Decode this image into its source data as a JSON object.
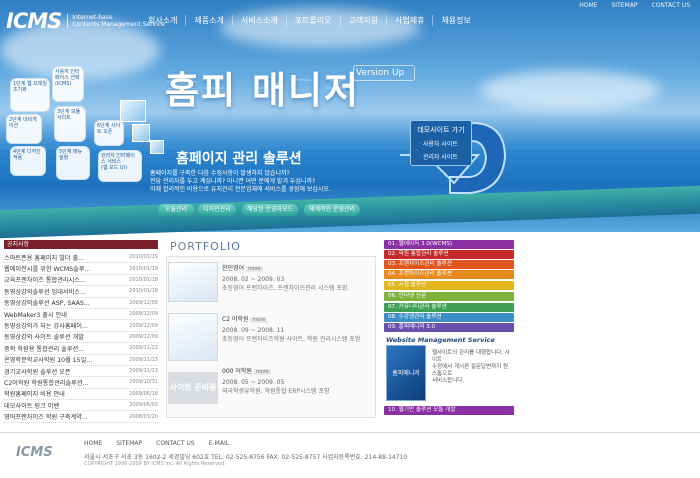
{
  "top_links": [
    "HOME",
    "SITEMAP",
    "CONTACT US"
  ],
  "logo": {
    "mark": "ICMS",
    "sub": [
      "Internet-base",
      "Contents Management Service"
    ]
  },
  "main_nav": [
    "회사소개",
    "제품소개",
    "서비스소개",
    "포트폴리오",
    "고객지원",
    "사업제휴",
    "채용정보"
  ],
  "hero": {
    "headline": "홈피 매니저",
    "version": "Version Up",
    "subhead": "홈페이지 관리 솔루션",
    "desc": [
      "홈페이지를 구축한 다음 수정사항이 발생하지 않습니까?",
      "전담 관리자를 두고 계십니까? 아니면 어떤 분에게 맡겨 두십니까?",
      "이제 합리적인 비용으로 유지관리 전문업체에 서비스를 경험해 보십시오."
    ],
    "demo": {
      "title": "데모사이트 가기",
      "items": [
        "사용자 사이트",
        "관리자 사이트"
      ]
    },
    "pills": [
      "모듈관리",
      "디자인관리",
      "해당된 운영자모드",
      "체계적인 운영관리"
    ],
    "tiles": [
      [
        "1단계 웹 프레임 초기화"
      ],
      [
        "사용자 인터페이스 선택",
        "(ICMS)"
      ],
      [
        "2단계 내비게이션"
      ],
      [
        "3단계 모듈 사이트"
      ],
      [
        "4단계 디자인 적용"
      ],
      [
        "5단계 메뉴 설정"
      ],
      [
        "관리자 인터페이스 서비스",
        "(웹 모드 UI)"
      ],
      [
        "6단계 사이트 오픈"
      ]
    ]
  },
  "notices": {
    "title": "공지사항",
    "items": [
      {
        "title": "스마트폰용 홈페이지 빌더 출...",
        "date": "2010/01/19"
      },
      {
        "title": "웹에이전시를 위한 WCMS솔루...",
        "date": "2010/01/19"
      },
      {
        "title": "교육프랜차이즈 통합관리시스...",
        "date": "2010/01/18"
      },
      {
        "title": "동영상강의솔루션 입대서비스...",
        "date": "2010/01/18"
      },
      {
        "title": "동영상강의솔루션 ASP, SAAS...",
        "date": "2009/12/09"
      },
      {
        "title": "WebMaker3 출시 안내",
        "date": "2009/12/09"
      },
      {
        "title": "동영상강의가 되는 강사홈페이...",
        "date": "2009/12/09"
      },
      {
        "title": "동영상강의 사이트 솔루션 개발",
        "date": "2009/12/09"
      },
      {
        "title": "중학 학원용 통합관리 솔루션...",
        "date": "2009/11/22"
      },
      {
        "title": "온영학문학교사학원 10월 15일...",
        "date": "2009/11/13"
      },
      {
        "title": "경기교사학원 솔루션 오픈",
        "date": "2009/11/13"
      },
      {
        "title": "C2어학원 학원통합관리솔루션...",
        "date": "2009/10/31"
      },
      {
        "title": "학원홈페이지 비용 안내",
        "date": "2009/06/18"
      },
      {
        "title": "데모사이트 링크 이벤",
        "date": "2009/06/02"
      },
      {
        "title": "영어프랜차이즈 학원 구축계약...",
        "date": "2008/03/20"
      }
    ]
  },
  "portfolio": {
    "title_a": "PORT",
    "title_b": "FOLIO",
    "items": [
      {
        "name": "한인영어",
        "badge": "more",
        "period": "2008. 02 ~ 2009. 03",
        "desc": "초등영어 프랜차이즈, 프랜차이즈관리 시스템 포함."
      },
      {
        "name": "C2 어학원",
        "badge": "more",
        "period": "2008. 09 ~ 2008. 11",
        "desc": "초등영어 프랜차이즈학원 사이트, 학원 관리시스템 포함"
      },
      {
        "name": "000 어학원",
        "badge": "more",
        "period": "2008. 05 ~ 2009. 05",
        "desc": "외국학생유학원, 학원통합 ERP시스템 포함"
      }
    ],
    "prep_banner": "사이트 준비중"
  },
  "menu": [
    {
      "label": "01. 웹에이저 3.0(WCMS)",
      "color": "#8b2fa4"
    },
    {
      "label": "02. 학원 통합관리 솔루션",
      "color": "#c42a2a"
    },
    {
      "label": "03. 프랜차이즈관리 솔루션",
      "color": "#e0561f"
    },
    {
      "label": "04. 프랜차이즈관리 솔루션",
      "color": "#e68a1c"
    },
    {
      "label": "05. 시험 솔루션",
      "color": "#e3b51a"
    },
    {
      "label": "06. 인터넷 신문",
      "color": "#7fb23b"
    },
    {
      "label": "07. 커뮤니티관리 솔루션",
      "color": "#3f9f55"
    },
    {
      "label": "08. 수강생관리 솔루션",
      "color": "#3a8fc4"
    },
    {
      "label": "09. 홈피매니저 3.0",
      "color": "#6a4fb0"
    }
  ],
  "wms": {
    "title": "Website Management Service",
    "box_label": "홈피매니저",
    "text": [
      "웹사이트의 관리를 대행합니다. 사이트",
      "수정에서 게시판 질문답변까지 원스톱으로",
      "서비스합니다."
    ]
  },
  "menu_bottom": {
    "label": "10. 웹기반 솔루션 모듈 개발",
    "color": "#8b2fa4"
  },
  "footer": {
    "logo": "ICMS",
    "links": [
      "HOME",
      "SITEMAP",
      "CONTACT US",
      "E-MAIL"
    ],
    "address": "서울시 서초구 서초 3동 1602-2 세경빌딩 602호 TEL: 02-525-8756 FAX: 02-525-8757 사업자등록번호: 214-88-14710",
    "copyright": "COPYRIGHT 1996-2009 BY ICMS Inc. All Rights Reserved."
  }
}
